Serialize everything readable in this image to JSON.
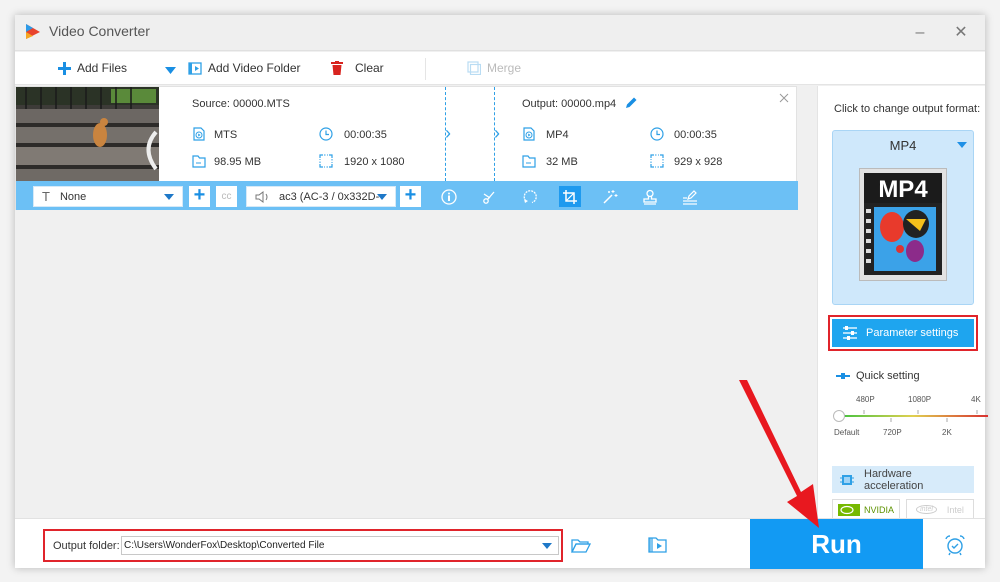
{
  "window": {
    "title": "Video Converter",
    "minimize_glyph": "–",
    "close_glyph": "✕"
  },
  "toolbar": {
    "add_files": "Add Files",
    "add_video_folder": "Add Video Folder",
    "clear": "Clear",
    "merge": "Merge"
  },
  "file": {
    "source_label": "Source: 00000.MTS",
    "source_format": "MTS",
    "source_duration": "00:00:35",
    "source_size": "98.95 MB",
    "source_resolution": "1920 x 1080",
    "output_label": "Output: 00000.mp4",
    "output_format": "MP4",
    "output_duration": "00:00:35",
    "output_size": "32 MB",
    "output_resolution": "929 x 928"
  },
  "edit_bar": {
    "subtitle_value": "None",
    "audio_value": "ac3 (AC-3 / 0x332D-",
    "tools": [
      "info-icon",
      "scissors-icon",
      "rotate-icon",
      "crop-icon",
      "effects-wand-icon",
      "watermark-stamp-icon",
      "edit-pen-icon"
    ],
    "active_tool": "crop-icon"
  },
  "right_panel": {
    "format_hint": "Click to change output format:",
    "format_name": "MP4",
    "format_thumbnail_text": "MP4",
    "parameter_settings": "Parameter settings",
    "quick_setting": "Quick setting",
    "slider_top_labels": [
      "480P",
      "1080P",
      "4K"
    ],
    "slider_bottom_labels": [
      "Default",
      "720P",
      "2K"
    ],
    "slider_value": "Default",
    "hardware_acceleration": "Hardware acceleration",
    "nvidia": "NVIDIA",
    "intel": "Intel",
    "intel_logo_text": "intel"
  },
  "bottom": {
    "output_folder_label": "Output folder:",
    "output_folder_value": "C:\\Users\\WonderFox\\Desktop\\Converted File",
    "run": "Run"
  },
  "colors": {
    "accent": "#129af3",
    "edit_bar": "#6cc0f5",
    "highlight_red": "#e0242b"
  }
}
